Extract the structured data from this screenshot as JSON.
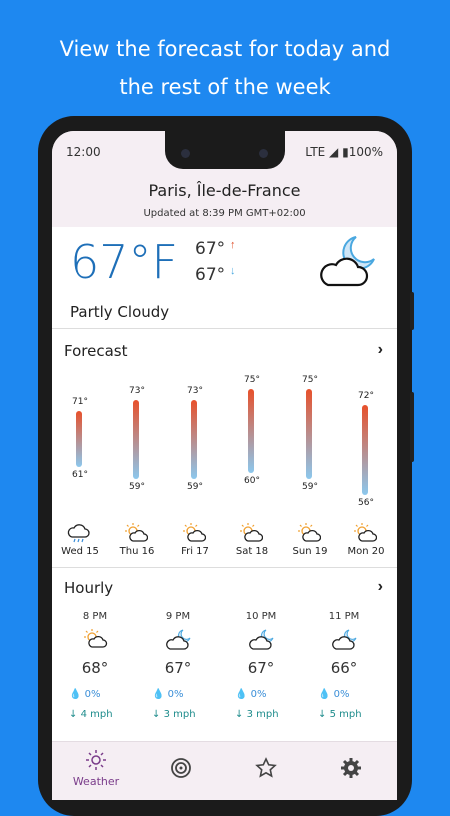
{
  "promo": {
    "line1": "View the forecast for today and",
    "line2": "the rest of the week"
  },
  "status": {
    "time": "12:00",
    "right": "LTE ◢ ▮100%"
  },
  "header": {
    "location": "Paris, Île-de-France",
    "updated": "Updated at 8:39 PM GMT+02:00"
  },
  "current": {
    "temp": "67°F",
    "hi": "67°",
    "lo": "67°",
    "condition": "Partly Cloudy",
    "icon": "night-partly-cloudy-icon"
  },
  "forecast": {
    "title": "Forecast",
    "days": [
      {
        "day": "Wed 15",
        "high": "71°",
        "low": "61°",
        "icon": "rain-cloud-icon"
      },
      {
        "day": "Thu 16",
        "high": "73°",
        "low": "59°",
        "icon": "partly-sunny-icon"
      },
      {
        "day": "Fri 17",
        "high": "73°",
        "low": "59°",
        "icon": "partly-sunny-icon"
      },
      {
        "day": "Sat 18",
        "high": "75°",
        "low": "60°",
        "icon": "partly-sunny-icon"
      },
      {
        "day": "Sun 19",
        "high": "75°",
        "low": "59°",
        "icon": "partly-sunny-icon"
      },
      {
        "day": "Mon 20",
        "high": "72°",
        "low": "56°",
        "icon": "partly-sunny-icon"
      }
    ]
  },
  "hourly": {
    "title": "Hourly",
    "hours": [
      {
        "time": "8 PM",
        "temp": "68°",
        "precip": "0%",
        "wind": "4 mph",
        "icon": "partly-sunny-icon"
      },
      {
        "time": "9 PM",
        "temp": "67°",
        "precip": "0%",
        "wind": "3 mph",
        "icon": "night-cloudy-icon"
      },
      {
        "time": "10 PM",
        "temp": "67°",
        "precip": "0%",
        "wind": "3 mph",
        "icon": "night-cloudy-icon"
      },
      {
        "time": "11 PM",
        "temp": "66°",
        "precip": "0%",
        "wind": "5 mph",
        "icon": "night-cloudy-icon"
      }
    ]
  },
  "nav": {
    "weather": "Weather"
  }
}
